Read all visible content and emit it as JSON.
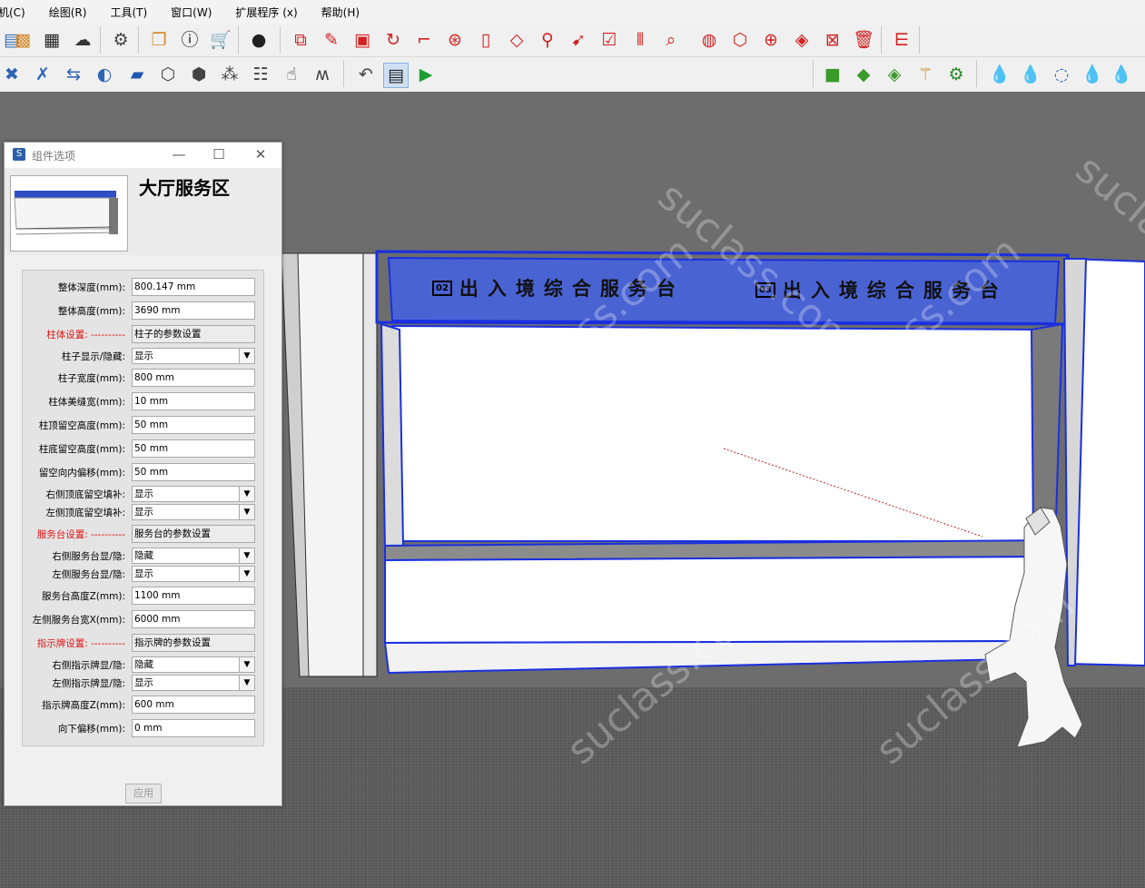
{
  "menubar": {
    "items": [
      "机(C)",
      "绘图(R)",
      "工具(T)",
      "窗口(W)",
      "扩展程序 (x)",
      "帮助(H)"
    ]
  },
  "toolbar1": {
    "icons": [
      "section-plane-icon",
      "pattern-icon",
      "checker-icon",
      "cloud-upload-icon",
      "settings-gear-icon",
      "layers-icon",
      "info-icon",
      "cart-icon",
      "account-icon",
      "bim-frame-icon",
      "edit-icon",
      "layout-icon",
      "rotate-icon",
      "stairs-icon",
      "pattern-circle-icon",
      "cylinder-icon",
      "cube-icon",
      "pin-icon",
      "cursor-icon",
      "checkbox-icon",
      "mirror-icon",
      "zoom-icon",
      "globe-icon",
      "dice-icon",
      "target-icon",
      "paint-icon",
      "sign-icon",
      "trash-icon",
      "brand-logo-icon"
    ]
  },
  "toolbar2": {
    "icons": [
      "tools-icon",
      "wrench-icon",
      "swap-icon",
      "toggle-icon",
      "folder-icon",
      "box-icon",
      "box-outline-icon",
      "boxes-icon",
      "stack-icon",
      "hand-icon",
      "sketch-icon",
      "undo-icon",
      "window-icon",
      "play-icon",
      "green-cube-icon",
      "green-cube-gear-icon",
      "green-cube-alt-icon",
      "broom-icon",
      "gear-green-icon",
      "drop-icon",
      "drop-plane-icon",
      "drop-outline-icon",
      "drop-small-icon",
      "drop-axes-icon"
    ]
  },
  "scene": {
    "sign_text_left": "出入境综合服务台",
    "sign_text_right": "出入境综合服务台",
    "sign_badge_left": "02",
    "sign_badge_right": "03",
    "watermark": "suclass.com",
    "colors": {
      "sign_blue": "#4a63d3",
      "edge_blue": "#1a2fe0"
    }
  },
  "dialog": {
    "title": "组件选项",
    "heading": "大厅服务区",
    "apply_label": "应用",
    "rows": [
      {
        "label": "整体深度(mm):",
        "value": "800.147 mm",
        "type": "input"
      },
      {
        "label": "整体高度(mm):",
        "value": "3690 mm",
        "type": "input"
      },
      {
        "label": "柱体设置: ----------",
        "value": "柱子的参数设置",
        "type": "group"
      },
      {
        "label": "柱子显示/隐藏:",
        "value": "显示",
        "type": "select"
      },
      {
        "label": "柱子宽度(mm):",
        "value": "800 mm",
        "type": "input"
      },
      {
        "label": "柱体美缝宽(mm):",
        "value": "10 mm",
        "type": "input"
      },
      {
        "label": "柱顶留空高度(mm):",
        "value": "50 mm",
        "type": "input"
      },
      {
        "label": "柱底留空高度(mm):",
        "value": "50 mm",
        "type": "input"
      },
      {
        "label": "留空向内偏移(mm):",
        "value": "50 mm",
        "type": "input"
      },
      {
        "label": "右侧顶底留空填补:",
        "value": "显示",
        "type": "select"
      },
      {
        "label": "左侧顶底留空填补:",
        "value": "显示",
        "type": "select"
      },
      {
        "label": "服务台设置: ----------",
        "value": "服务台的参数设置",
        "type": "group"
      },
      {
        "label": "右侧服务台显/隐:",
        "value": "隐藏",
        "type": "select"
      },
      {
        "label": "左侧服务台显/隐:",
        "value": "显示",
        "type": "select"
      },
      {
        "label": "服务台高度Z(mm):",
        "value": "1100 mm",
        "type": "input"
      },
      {
        "label": "左侧服务台宽X(mm):",
        "value": "6000 mm",
        "type": "input"
      },
      {
        "label": "指示牌设置: ----------",
        "value": "指示牌的参数设置",
        "type": "group"
      },
      {
        "label": "右侧指示牌显/隐:",
        "value": "隐藏",
        "type": "select"
      },
      {
        "label": "左侧指示牌显/隐:",
        "value": "显示",
        "type": "select"
      },
      {
        "label": "指示牌高度Z(mm):",
        "value": "600 mm",
        "type": "input"
      },
      {
        "label": "向下偏移(mm):",
        "value": "0 mm",
        "type": "input"
      }
    ]
  }
}
